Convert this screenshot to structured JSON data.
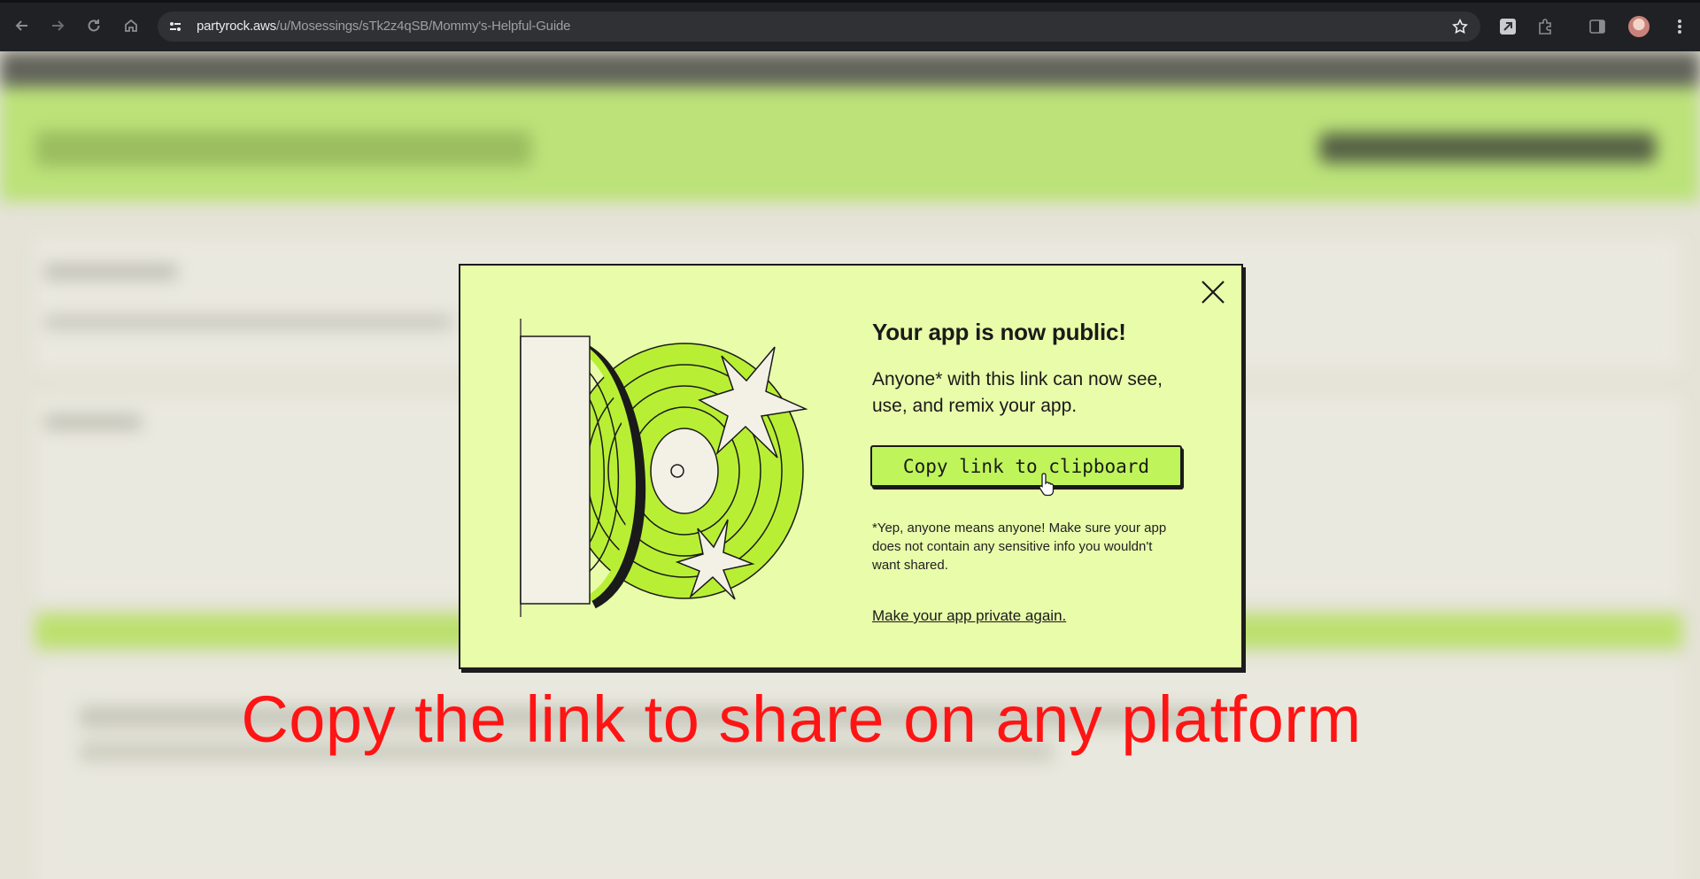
{
  "browser": {
    "url_host": "partyrock.aws",
    "url_path": "/u/Mosessings/sTk2z4qSB/Mommy's-Helpful-Guide"
  },
  "modal": {
    "heading": "Your app is now public!",
    "description": "Anyone* with this link can now see, use, and remix your app.",
    "copy_button_label": "Copy link to clipboard",
    "note": "*Yep, anyone means anyone! Make sure your app does not contain any sensitive info you wouldn't want shared.",
    "private_link": "Make your app private again."
  },
  "caption": "Copy the link to share on any platform",
  "colors": {
    "modal_bg": "#e8fcaa",
    "accent_green": "#bff55a",
    "caption_red": "#ff1414"
  }
}
